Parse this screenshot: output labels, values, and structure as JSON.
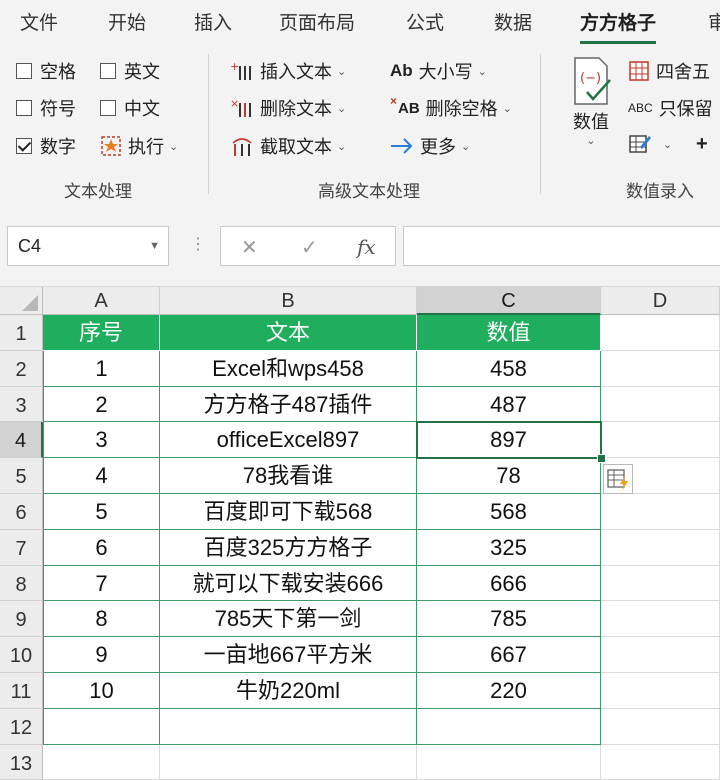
{
  "ribbon_tabs": [
    "文件",
    "开始",
    "插入",
    "页面布局",
    "公式",
    "数据",
    "方方格子",
    "审"
  ],
  "active_tab": "方方格子",
  "text_group": {
    "checkbox_space": "空格",
    "checkbox_english": "英文",
    "checkbox_symbol": "符号",
    "checkbox_chinese": "中文",
    "checkbox_number": "数字",
    "execute": "执行",
    "label": "文本处理"
  },
  "advanced_group": {
    "insert_text": "插入文本",
    "delete_text": "删除文本",
    "extract_text": "截取文本",
    "case": "大小写",
    "delete_spaces": "删除空格",
    "more": "更多",
    "label": "高级文本处理",
    "case_icon": "Ab",
    "delete_spaces_icon": "AB"
  },
  "value_group": {
    "numeric": "数值",
    "round": "四舍五",
    "keep_only": "只保留",
    "label": "数值录入",
    "keep_icon": "ABC",
    "plus": "+"
  },
  "formula_bar": {
    "name_box": "C4",
    "dots": "⋮",
    "cancel": "✕",
    "confirm": "✓",
    "fx": "fx",
    "formula": ""
  },
  "sheet": {
    "columns": [
      "A",
      "B",
      "C",
      "D"
    ],
    "selected_column": "C",
    "selected_row": "4",
    "row_numbers": [
      "1",
      "2",
      "3",
      "4",
      "5",
      "6",
      "7",
      "8",
      "9",
      "10",
      "11",
      "12",
      "13"
    ],
    "headers": [
      "序号",
      "文本",
      "数值"
    ],
    "rows": [
      [
        "1",
        "Excel和wps458",
        "458"
      ],
      [
        "2",
        "方方格子487插件",
        "487"
      ],
      [
        "3",
        "officeExcel897",
        "897"
      ],
      [
        "4",
        "78我看谁",
        "78"
      ],
      [
        "5",
        "百度即可下载568",
        "568"
      ],
      [
        "6",
        "百度325方方格子",
        "325"
      ],
      [
        "7",
        "就可以下载安装666",
        "666"
      ],
      [
        "8",
        "785天下第一剑",
        "785"
      ],
      [
        "9",
        "一亩地667平方米",
        "667"
      ],
      [
        "10",
        "牛奶220ml",
        "220"
      ]
    ]
  },
  "colors": {
    "accent": "#217346",
    "header_fill": "#1fad5e",
    "table_border": "#3c9c6c"
  }
}
